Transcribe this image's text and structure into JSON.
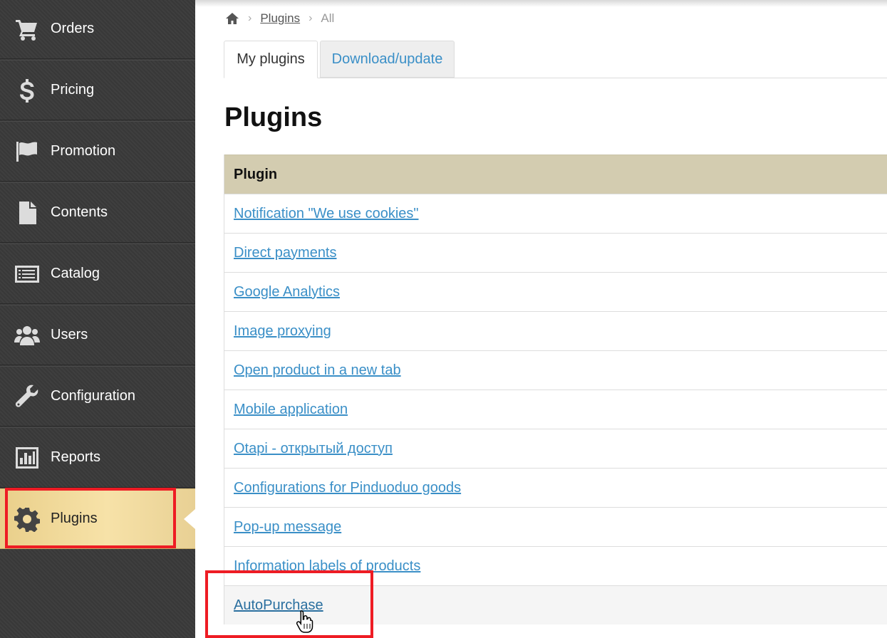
{
  "sidebar": {
    "items": [
      {
        "label": "Orders",
        "icon": "cart-icon"
      },
      {
        "label": "Pricing",
        "icon": "dollar-icon"
      },
      {
        "label": "Promotion",
        "icon": "flag-icon"
      },
      {
        "label": "Contents",
        "icon": "file-icon"
      },
      {
        "label": "Catalog",
        "icon": "list-icon"
      },
      {
        "label": "Users",
        "icon": "users-icon"
      },
      {
        "label": "Configuration",
        "icon": "wrench-icon"
      },
      {
        "label": "Reports",
        "icon": "bar-chart-icon"
      },
      {
        "label": "Plugins",
        "icon": "gear-icon",
        "active": true
      }
    ]
  },
  "breadcrumb": {
    "home_icon": "home-icon",
    "separator": "›",
    "link": "Plugins",
    "current": "All"
  },
  "tabs": {
    "my_plugins": "My plugins",
    "download_update": "Download/update"
  },
  "page_title": "Plugins",
  "table": {
    "header": "Plugin",
    "rows": [
      "Notification \"We use cookies\"",
      "Direct payments",
      "Google Analytics",
      "Image proxying",
      "Open product in a new tab",
      "Mobile application",
      "Otapi - открытый доступ",
      "Configurations for Pinduoduo goods",
      "Pop-up message",
      "Information labels of products",
      "AutoPurchase"
    ]
  },
  "colors": {
    "sidebar_bg": "#3a3a3a",
    "active_item_bg": "#f3dc9f",
    "table_header_bg": "#d3ccb0",
    "link": "#3a8fc7",
    "annotation_red": "#ee1c24"
  }
}
